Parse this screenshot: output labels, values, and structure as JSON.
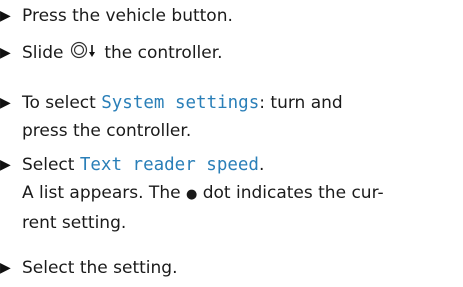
{
  "colors": {
    "text": "#1a1a1a",
    "ui_term": "#2a7fb8"
  },
  "icons": {
    "bullet": "triangle-right-icon",
    "controller": "controller-slide-down-icon",
    "dot": "filled-dot-icon"
  },
  "steps": [
    {
      "text": "Press the vehicle button."
    },
    {
      "before": "Slide",
      "after": "the controller."
    },
    {
      "before": "To select",
      "term": "System settings",
      "after": ": turn and",
      "line2": "press the controller."
    },
    {
      "before": "Select",
      "term": "Text reader speed",
      "after": ".",
      "line2_before": "A list appears. The",
      "dot": "●",
      "line2_after": "dot indicates the cur-",
      "line3": "rent setting."
    },
    {
      "text": "Select the setting."
    }
  ]
}
